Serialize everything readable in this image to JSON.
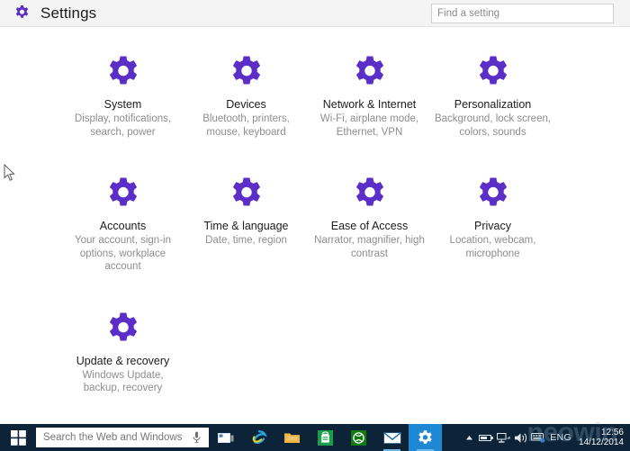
{
  "window": {
    "title": "Settings",
    "title_icon": "gear-icon"
  },
  "colors": {
    "accent_purple": "#5b2ec8",
    "taskbar": "#0d2438",
    "taskbar_active": "#1e88d4",
    "titlebar_bg": "#f4f4f4",
    "body_bg": "#ffffff",
    "tile_title": "#1d1d1d",
    "tile_desc": "#8d8d8d"
  },
  "search": {
    "value": "",
    "placeholder": "Find a setting",
    "icon": "search-icon"
  },
  "tiles": [
    {
      "icon": "gear-icon",
      "title": "System",
      "desc": "Display, notifications, search, power"
    },
    {
      "icon": "gear-icon",
      "title": "Devices",
      "desc": "Bluetooth, printers, mouse, keyboard"
    },
    {
      "icon": "gear-icon",
      "title": "Network & Internet",
      "desc": "Wi-Fi, airplane mode, Ethernet, VPN"
    },
    {
      "icon": "gear-icon",
      "title": "Personalization",
      "desc": "Background, lock screen, colors, sounds"
    },
    {
      "icon": "gear-icon",
      "title": "Accounts",
      "desc": "Your account, sign-in options, workplace account"
    },
    {
      "icon": "gear-icon",
      "title": "Time & language",
      "desc": "Date, time, region"
    },
    {
      "icon": "gear-icon",
      "title": "Ease of Access",
      "desc": "Narrator, magnifier, high contrast"
    },
    {
      "icon": "gear-icon",
      "title": "Privacy",
      "desc": "Location, webcam, microphone"
    },
    {
      "icon": "gear-icon",
      "title": "Update & recovery",
      "desc": "Windows Update, backup, recovery"
    }
  ],
  "taskbar": {
    "start": {
      "icon": "windows-logo-icon",
      "label": "Start"
    },
    "search": {
      "placeholder": "Search the Web and Windows",
      "value": "",
      "mic_icon": "microphone-icon"
    },
    "buttons": [
      {
        "icon": "task-view-icon",
        "name": "task-view",
        "active": false,
        "running": false
      },
      {
        "icon": "internet-explorer-icon",
        "name": "internet-explorer",
        "active": false,
        "running": false
      },
      {
        "icon": "file-explorer-icon",
        "name": "file-explorer",
        "active": false,
        "running": false
      },
      {
        "icon": "store-icon",
        "name": "store",
        "active": false,
        "running": false
      },
      {
        "icon": "xbox-icon",
        "name": "xbox",
        "active": false,
        "running": false
      },
      {
        "icon": "mail-icon",
        "name": "mail",
        "active": false,
        "running": true
      },
      {
        "icon": "gear-icon",
        "name": "settings",
        "active": true,
        "running": true
      }
    ],
    "tray": {
      "icons": [
        {
          "icon": "show-hidden-icons-chevron-icon"
        },
        {
          "icon": "battery-icon"
        },
        {
          "icon": "network-icon"
        },
        {
          "icon": "volume-icon"
        },
        {
          "icon": "input-indicator-icon"
        }
      ],
      "language": "ENG",
      "time": "12:56",
      "date": "14/12/2014"
    }
  },
  "watermark": {
    "text": "neowin"
  }
}
